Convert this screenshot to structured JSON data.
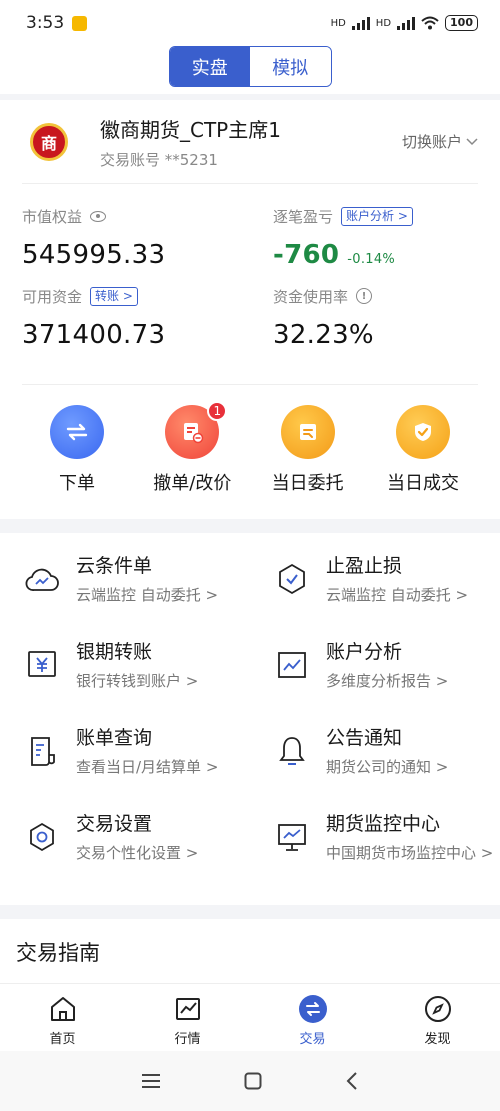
{
  "status": {
    "time": "3:53",
    "battery": "100",
    "hd1": "HD",
    "hd2": "HD"
  },
  "toggle": {
    "real": "实盘",
    "sim": "模拟"
  },
  "account": {
    "logo_text": "商",
    "name": "徽商期货_CTP主席1",
    "number": "交易账号 **5231",
    "switch": "切换账户"
  },
  "metrics": {
    "equity_label": "市值权益",
    "equity_value": "545995.33",
    "pnl_label": "逐笔盈亏",
    "pnl_tag": "账户分析 >",
    "pnl_value": "-760",
    "pnl_pct": "-0.14%",
    "avail_label": "可用资金",
    "avail_tag": "转账 >",
    "avail_value": "371400.73",
    "usage_label": "资金使用率",
    "usage_value": "32.23%"
  },
  "quick": {
    "order": "下单",
    "cancel": "撤单/改价",
    "cancel_badge": "1",
    "today_orders": "当日委托",
    "today_trades": "当日成交"
  },
  "features": {
    "cloud": {
      "title": "云条件单",
      "sub": "云端监控 自动委托 >"
    },
    "stop": {
      "title": "止盈止损",
      "sub": "云端监控 自动委托 >"
    },
    "transfer": {
      "title": "银期转账",
      "sub": "银行转钱到账户 >"
    },
    "analysis": {
      "title": "账户分析",
      "sub": "多维度分析报告 >"
    },
    "bill": {
      "title": "账单查询",
      "sub": "查看当日/月结算单 >"
    },
    "notice": {
      "title": "公告通知",
      "sub": "期货公司的通知 >"
    },
    "settings": {
      "title": "交易设置",
      "sub": "交易个性化设置 >"
    },
    "monitor": {
      "title": "期货监控中心",
      "sub": "中国期货市场监控中心 >"
    }
  },
  "guide": {
    "title": "交易指南"
  },
  "nav": {
    "home": "首页",
    "market": "行情",
    "trade": "交易",
    "discover": "发现"
  },
  "colors": {
    "accent": "#3a5fcd",
    "profit_green": "#1e8a44",
    "badge_red": "#e8303a"
  }
}
